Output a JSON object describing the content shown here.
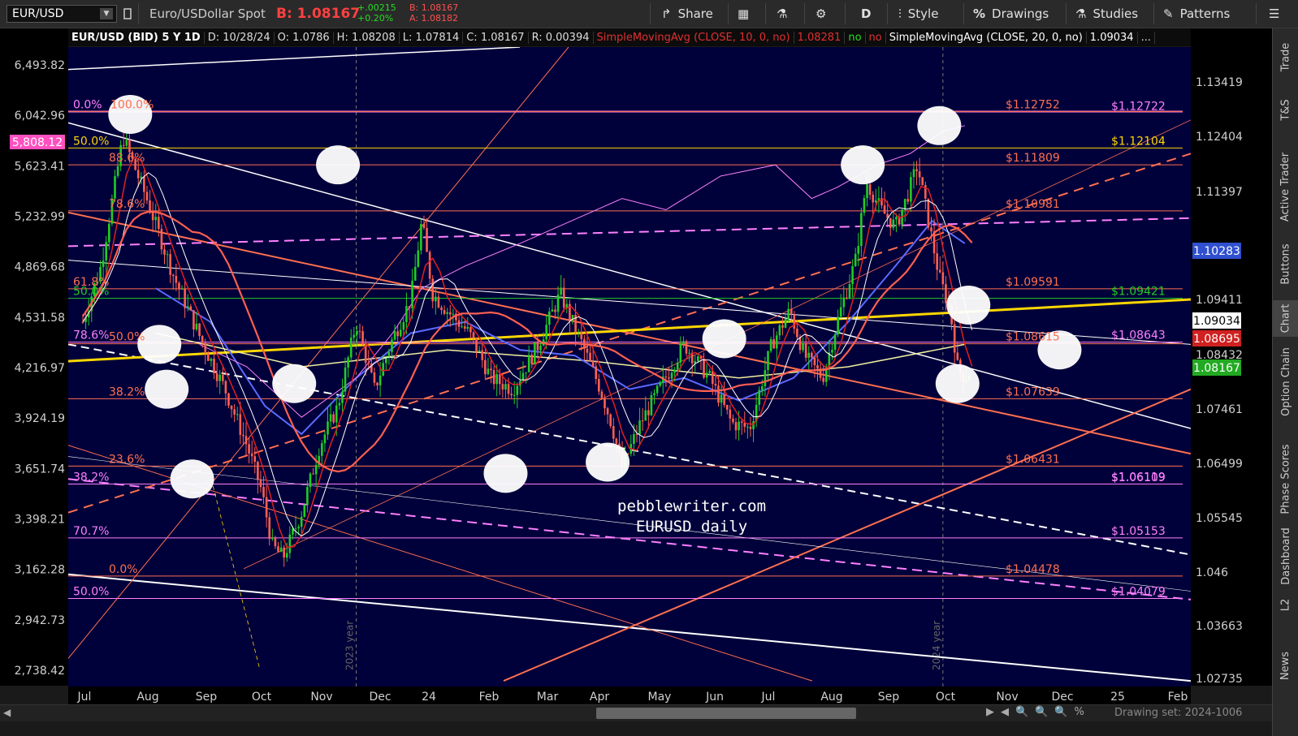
{
  "toolbar": {
    "symbol": "EUR/USD",
    "description": "Euro/USDollar Spot",
    "bid": "B: 1.08167",
    "change_abs": "+.00215",
    "change_pct": "+0.20%",
    "bid_small": "B: 1.08167",
    "ask_small": "A: 1.08182",
    "share": "Share",
    "period": "D",
    "style": "Style",
    "drawings": "Drawings",
    "studies": "Studies",
    "patterns": "Patterns"
  },
  "status": {
    "title": "EUR/USD (BID) 5 Y 1D",
    "date": "D: 10/28/24",
    "open": "O: 1.0786",
    "high": "H: 1.08208",
    "low": "L: 1.07814",
    "close": "C: 1.08167",
    "range": "R: 0.00394",
    "sma10": "SimpleMovingAvg (CLOSE, 10, 0, no)",
    "sma10_val": "1.08281",
    "no1": "no",
    "no2": "no",
    "sma20": "SimpleMovingAvg (CLOSE, 20, 0, no)",
    "sma20_val": "1.09034",
    "more": "..."
  },
  "side_tabs": [
    "Trade",
    "T&S",
    "Active Trader",
    "Buttons",
    "Chart",
    "Option Chain",
    "Phase Scores",
    "Dashboard",
    "L2",
    "News"
  ],
  "bottom": {
    "drawing_set": "Drawing set: 2024-1006"
  },
  "colors": {
    "background": "#00003a",
    "fib_red": "#ff7050",
    "magenta": "#ff80ff",
    "yellow": "#ffd700",
    "green": "#22cc22",
    "sma_blue": "#5a6bff"
  },
  "chart_data": {
    "type": "line",
    "symbol": "EURUSD",
    "watermark_line1": "pebblewriter.com",
    "watermark_line2": "EURUSD daily",
    "x_ticks": [
      "Jul",
      "Aug",
      "Sep",
      "Oct",
      "Nov",
      "Dec",
      "24",
      "Feb",
      "Mar",
      "Apr",
      "May",
      "Jun",
      "Jul",
      "Aug",
      "Sep",
      "Oct",
      "Nov",
      "Dec",
      "25",
      "Feb"
    ],
    "year_markers": [
      "2023 year",
      "2024 year"
    ],
    "left_axis_ticks": [
      "6,493.82",
      "6,042.96",
      "5,623.41",
      "5,232.99",
      "4,869.68",
      "4,531.58",
      "4,216.97",
      "3,924.19",
      "3,651.74",
      "3,398.21",
      "3,162.28",
      "2,942.73",
      "2,738.42"
    ],
    "left_axis_flag": "5,808.12",
    "right_axis_ticks": [
      "1.13419",
      "1.12404",
      "1.11397",
      "1.09411",
      "1.08432",
      "1.07461",
      "1.06499",
      "1.05545",
      "1.046",
      "1.03663",
      "1.02735"
    ],
    "right_flags": [
      {
        "label": "1.10283",
        "color": "#3050d0"
      },
      {
        "label": "1.09034",
        "color": "#ffffff"
      },
      {
        "label": "1.08695",
        "color": "#d02020"
      },
      {
        "label": "1.08167",
        "color": "#22aa22"
      }
    ],
    "fib_levels_left": [
      {
        "label": "0.0%",
        "price": 1.1275,
        "color": "#ff80ff"
      },
      {
        "label": "100.0%",
        "price": 1.1275,
        "color": "#ff7050"
      },
      {
        "label": "50.0%",
        "price": 1.121,
        "color": "#ffd700"
      },
      {
        "label": "88.6%",
        "price": 1.118,
        "color": "#ff7050"
      },
      {
        "label": "78.6%",
        "price": 1.1098,
        "color": "#ff7050"
      },
      {
        "label": "61.8%",
        "price": 1.0959,
        "color": "#ff7050"
      },
      {
        "label": "50.0%",
        "price": 1.0942,
        "color": "#22cc22"
      },
      {
        "label": "78.6%",
        "price": 1.0864,
        "color": "#ff80ff"
      },
      {
        "label": "50.0%",
        "price": 1.0861,
        "color": "#ff7050"
      },
      {
        "label": "38.2%",
        "price": 1.0763,
        "color": "#ff7050"
      },
      {
        "label": "23.6%",
        "price": 1.0643,
        "color": "#ff7050"
      },
      {
        "label": "38.2%",
        "price": 1.0611,
        "color": "#ff80ff"
      },
      {
        "label": "70.7%",
        "price": 1.0515,
        "color": "#ff80ff"
      },
      {
        "label": "0.0%",
        "price": 1.0447,
        "color": "#ff7050"
      },
      {
        "label": "50.0%",
        "price": 1.0407,
        "color": "#ff80ff"
      }
    ],
    "fib_levels_right": [
      {
        "label": "$1.12752",
        "price": 1.1275,
        "color": "#ff7050",
        "col": "a"
      },
      {
        "label": "$1.12722",
        "price": 1.1272,
        "color": "#ff80ff",
        "col": "b"
      },
      {
        "label": "$1.12104",
        "price": 1.121,
        "color": "#ffd700",
        "col": "b"
      },
      {
        "label": "$1.11809",
        "price": 1.118,
        "color": "#ff7050",
        "col": "a"
      },
      {
        "label": "$1.10981",
        "price": 1.1098,
        "color": "#ff7050",
        "col": "a"
      },
      {
        "label": "$1.09591",
        "price": 1.0959,
        "color": "#ff7050",
        "col": "a"
      },
      {
        "label": "$1.09421",
        "price": 1.0942,
        "color": "#22cc22",
        "col": "b"
      },
      {
        "label": "$1.08615",
        "price": 1.0861,
        "color": "#ff7050",
        "col": "a"
      },
      {
        "label": "$1.08643",
        "price": 1.0864,
        "color": "#ff80ff",
        "col": "b"
      },
      {
        "label": "$1.07639",
        "price": 1.0763,
        "color": "#ff7050",
        "col": "a"
      },
      {
        "label": "$1.06431",
        "price": 1.0643,
        "color": "#ff7050",
        "col": "a"
      },
      {
        "label": "$1.06119",
        "price": 1.0611,
        "color": "#ff80ff",
        "col": "b"
      },
      {
        "label": "$1.06109",
        "price": 1.061,
        "color": "#ff80ff",
        "col": "b"
      },
      {
        "label": "$1.05153",
        "price": 1.0515,
        "color": "#ff80ff",
        "col": "b"
      },
      {
        "label": "$1.04478",
        "price": 1.0447,
        "color": "#ff7050",
        "col": "a"
      },
      {
        "label": "$1.04079",
        "price": 1.0407,
        "color": "#ff80ff",
        "col": "b"
      }
    ],
    "y_range": [
      1.025,
      1.139
    ],
    "x_range_months": [
      "2023-06-20",
      "2025-02-20"
    ],
    "price_path": [
      [
        0,
        1.09
      ],
      [
        10,
        1.1
      ],
      [
        22,
        1.123
      ],
      [
        35,
        1.112
      ],
      [
        50,
        1.098
      ],
      [
        66,
        1.086
      ],
      [
        78,
        1.078
      ],
      [
        90,
        1.068
      ],
      [
        98,
        1.06
      ],
      [
        104,
        1.05
      ],
      [
        110,
        1.048
      ],
      [
        120,
        1.056
      ],
      [
        130,
        1.068
      ],
      [
        140,
        1.075
      ],
      [
        150,
        1.09
      ],
      [
        160,
        1.078
      ],
      [
        170,
        1.087
      ],
      [
        180,
        1.094
      ],
      [
        186,
        1.108
      ],
      [
        192,
        1.095
      ],
      [
        200,
        1.092
      ],
      [
        212,
        1.088
      ],
      [
        224,
        1.08
      ],
      [
        236,
        1.078
      ],
      [
        250,
        1.086
      ],
      [
        262,
        1.095
      ],
      [
        274,
        1.086
      ],
      [
        284,
        1.078
      ],
      [
        290,
        1.072
      ],
      [
        296,
        1.064
      ],
      [
        306,
        1.072
      ],
      [
        318,
        1.079
      ],
      [
        330,
        1.086
      ],
      [
        344,
        1.08
      ],
      [
        356,
        1.072
      ],
      [
        366,
        1.071
      ],
      [
        378,
        1.086
      ],
      [
        388,
        1.092
      ],
      [
        396,
        1.084
      ],
      [
        406,
        1.08
      ],
      [
        414,
        1.09
      ],
      [
        424,
        1.101
      ],
      [
        430,
        1.115
      ],
      [
        438,
        1.11
      ],
      [
        446,
        1.107
      ],
      [
        452,
        1.112
      ],
      [
        458,
        1.118
      ],
      [
        464,
        1.108
      ],
      [
        470,
        1.098
      ],
      [
        476,
        1.092
      ],
      [
        480,
        1.082
      ],
      [
        484,
        1.08
      ],
      [
        488,
        1.0817
      ]
    ],
    "magenta_path": [
      [
        64,
        1.086
      ],
      [
        90,
        1.082
      ],
      [
        120,
        1.073
      ],
      [
        150,
        1.08
      ],
      [
        170,
        1.088
      ],
      [
        186,
        1.096
      ],
      [
        210,
        1.1
      ],
      [
        240,
        1.104
      ],
      [
        268,
        1.108
      ],
      [
        296,
        1.112
      ],
      [
        320,
        1.11
      ],
      [
        350,
        1.116
      ],
      [
        380,
        1.118
      ],
      [
        400,
        1.112
      ],
      [
        414,
        1.114
      ],
      [
        436,
        1.118
      ],
      [
        454,
        1.12
      ],
      [
        472,
        1.124
      ],
      [
        484,
        1.125
      ]
    ],
    "sma50_path": [
      [
        40,
        1.096
      ],
      [
        70,
        1.09
      ],
      [
        100,
        1.075
      ],
      [
        120,
        1.07
      ],
      [
        150,
        1.08
      ],
      [
        180,
        1.088
      ],
      [
        210,
        1.09
      ],
      [
        240,
        1.085
      ],
      [
        270,
        1.084
      ],
      [
        300,
        1.078
      ],
      [
        330,
        1.08
      ],
      [
        360,
        1.076
      ],
      [
        390,
        1.08
      ],
      [
        420,
        1.09
      ],
      [
        446,
        1.1
      ],
      [
        466,
        1.108
      ],
      [
        484,
        1.104
      ]
    ],
    "sma200_path": [
      [
        40,
        1.088
      ],
      [
        120,
        1.082
      ],
      [
        200,
        1.085
      ],
      [
        280,
        1.083
      ],
      [
        360,
        1.08
      ],
      [
        420,
        1.082
      ],
      [
        484,
        1.086
      ]
    ],
    "circles": [
      [
        26,
        1.127
      ],
      [
        140,
        1.118
      ],
      [
        42,
        1.086
      ],
      [
        46,
        1.078
      ],
      [
        60,
        1.062
      ],
      [
        116,
        1.079
      ],
      [
        232,
        1.063
      ],
      [
        288,
        1.065
      ],
      [
        352,
        1.087
      ],
      [
        428,
        1.118
      ],
      [
        470,
        1.125
      ],
      [
        486,
        1.093
      ],
      [
        480,
        1.079
      ],
      [
        536,
        1.085
      ]
    ]
  }
}
